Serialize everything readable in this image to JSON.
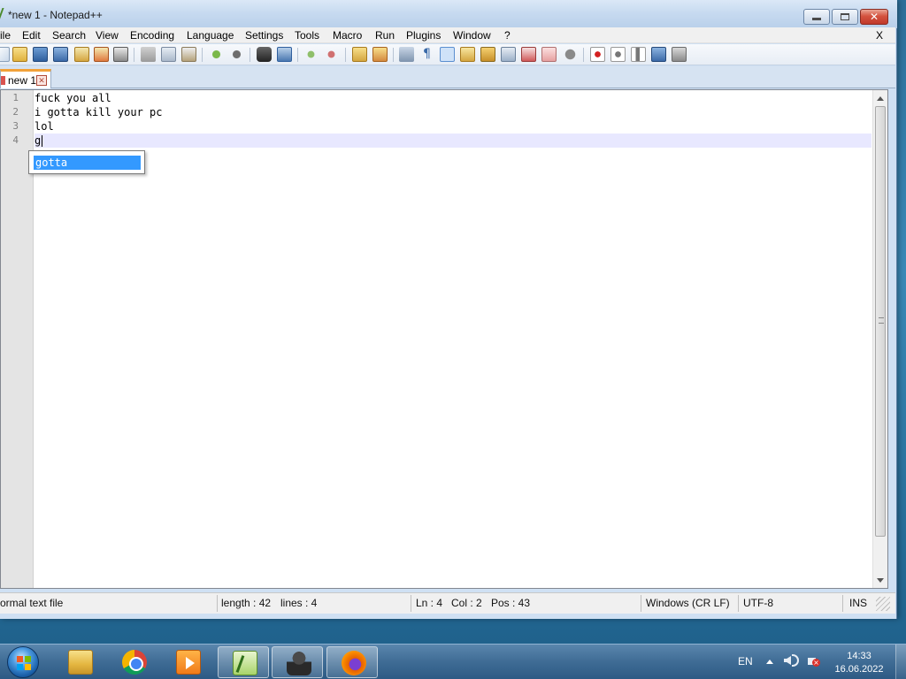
{
  "window": {
    "title": "*new 1 - Notepad++"
  },
  "menu": {
    "items": [
      "ile",
      "Edit",
      "Search",
      "View",
      "Encoding",
      "Language",
      "Settings",
      "Tools",
      "Macro",
      "Run",
      "Plugins",
      "Window",
      "?"
    ],
    "close_x": "X"
  },
  "tabs": [
    {
      "label": "new 1",
      "modified": true,
      "active": true
    }
  ],
  "editor": {
    "line_numbers": [
      "1",
      "2",
      "3",
      "4"
    ],
    "lines": [
      "fuck you all",
      "i gotta kill your pc",
      "lol",
      "g"
    ],
    "current_line": 4,
    "autocomplete": {
      "items": [
        "gotta"
      ],
      "selected": "gotta"
    }
  },
  "statusbar": {
    "file_type": "ormal text file",
    "length": "length : 42",
    "lines": "lines : 4",
    "ln": "Ln : 4",
    "col": "Col : 2",
    "pos": "Pos : 43",
    "eol": "Windows (CR LF)",
    "encoding": "UTF-8",
    "mode": "INS"
  },
  "taskbar": {
    "apps": [
      {
        "name": "windows-explorer",
        "icon": "folder-icon",
        "active": false
      },
      {
        "name": "google-chrome",
        "icon": "chrome-icon",
        "active": false
      },
      {
        "name": "media-player",
        "icon": "media-player-icon",
        "active": false
      },
      {
        "name": "notepad-plus-plus",
        "icon": "notepad-plus-plus-icon",
        "active": true
      },
      {
        "name": "chess",
        "icon": "chess-icon",
        "active": true
      },
      {
        "name": "firefox",
        "icon": "firefox-icon",
        "active": true
      }
    ],
    "tray": {
      "language": "EN",
      "time": "14:33",
      "date": "16.06.2022"
    }
  },
  "colors": {
    "selection": "#3399ff",
    "current_line": "#e8e8ff",
    "tab_accent": "#f2a23a",
    "close_button": "#c0392b"
  }
}
